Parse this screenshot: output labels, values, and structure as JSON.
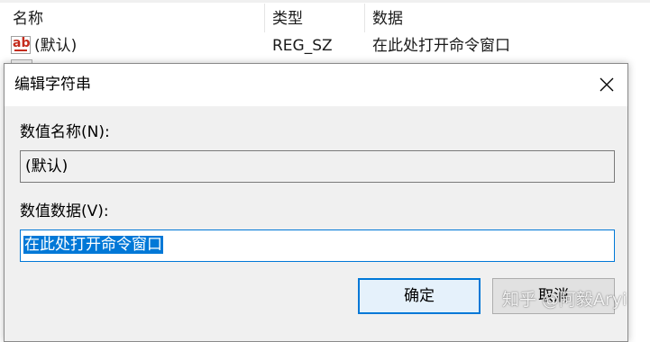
{
  "registry_list": {
    "columns": {
      "name": "名称",
      "type": "类型",
      "data": "数据"
    },
    "rows": [
      {
        "icon": "string-value-icon",
        "icon_text": "ab",
        "name": "(默认)",
        "type": "REG_SZ",
        "data": "在此处打开命令窗口"
      }
    ]
  },
  "dialog": {
    "title": "编辑字符串",
    "close_icon": "close-icon",
    "value_name_label": "数值名称(N):",
    "value_name": "(默认)",
    "value_data_label": "数值数据(V):",
    "value_data": "在此处打开命令窗口",
    "ok_label": "确定",
    "cancel_label": "取消"
  },
  "watermark": "知乎 @阿毅Aryi",
  "colors": {
    "accent": "#0078d7",
    "dialog_bg": "#f0f0f0",
    "icon_red": "#c42b1c"
  }
}
